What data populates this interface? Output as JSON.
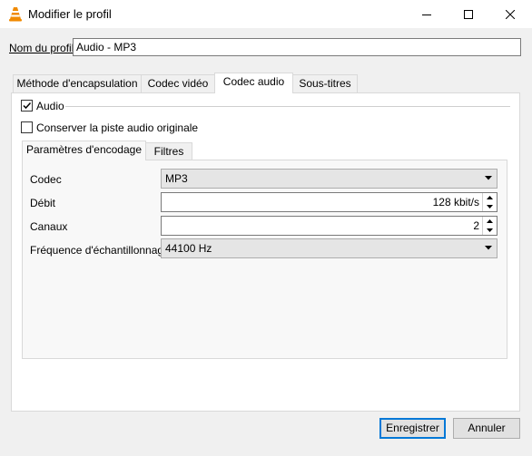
{
  "window": {
    "title": "Modifier le profil",
    "icon": "vlc-cone-icon"
  },
  "profile": {
    "name_label": "Nom du profil",
    "name_value": "Audio - MP3"
  },
  "tabs": [
    {
      "label": "Méthode d'encapsulation",
      "active": false
    },
    {
      "label": "Codec vidéo",
      "active": false
    },
    {
      "label": "Codec audio",
      "active": true
    },
    {
      "label": "Sous-titres",
      "active": false
    }
  ],
  "audio": {
    "audio_label": "Audio",
    "audio_checked": true,
    "keep_original_label": "Conserver la piste audio originale",
    "keep_original_checked": false
  },
  "subtabs": [
    {
      "label": "Paramètres d'encodage",
      "active": true
    },
    {
      "label": "Filtres",
      "active": false
    }
  ],
  "encoding": {
    "codec_label": "Codec",
    "codec_value": "MP3",
    "bitrate_label": "Débit",
    "bitrate_value": "128 kbit/s",
    "channels_label": "Canaux",
    "channels_value": "2",
    "samplerate_label": "Fréquence d'échantillonnage",
    "samplerate_value": "44100 Hz"
  },
  "buttons": {
    "save": "Enregistrer",
    "cancel": "Annuler"
  },
  "colors": {
    "accent": "#0078d7",
    "vlc_orange": "#f08a00"
  }
}
